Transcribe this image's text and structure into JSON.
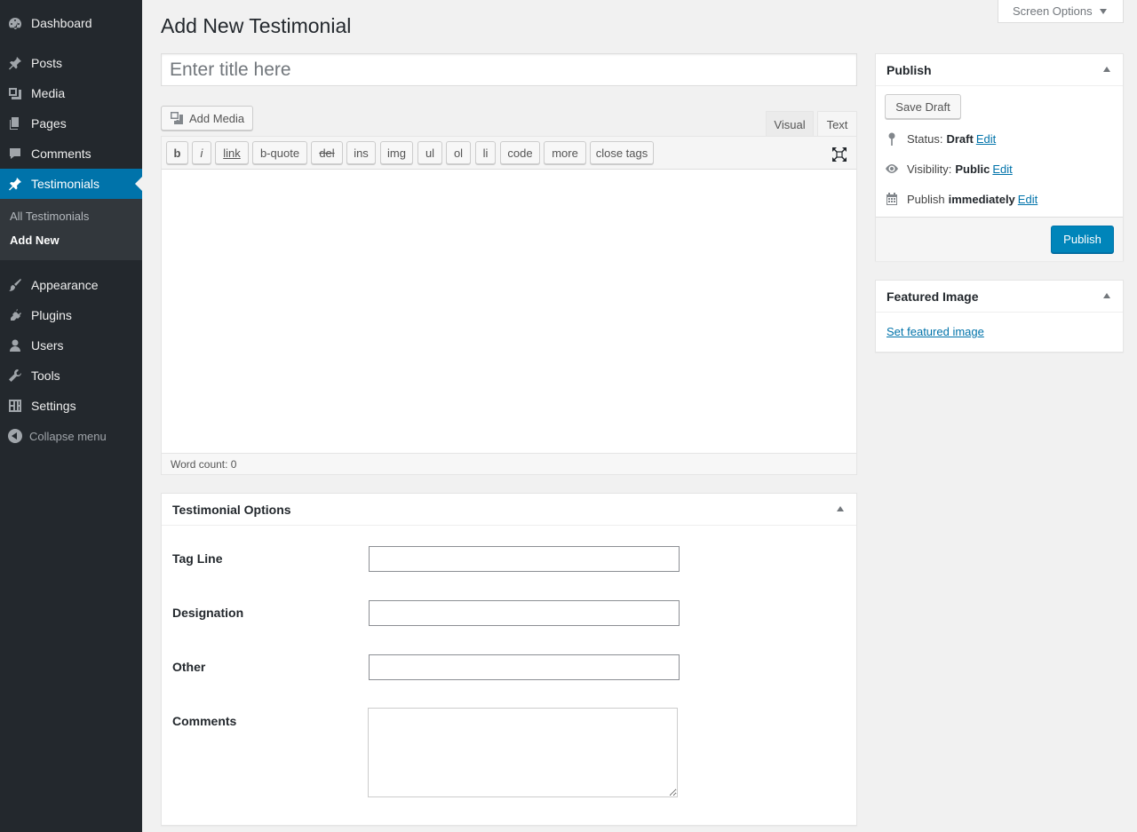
{
  "sidebar": {
    "items": [
      {
        "label": "Dashboard",
        "icon": "dashboard-icon"
      },
      {
        "label": "Posts",
        "icon": "pushpin-icon"
      },
      {
        "label": "Media",
        "icon": "media-icon"
      },
      {
        "label": "Pages",
        "icon": "pages-icon"
      },
      {
        "label": "Comments",
        "icon": "comment-icon"
      },
      {
        "label": "Testimonials",
        "icon": "pushpin-icon",
        "active": true
      },
      {
        "label": "Appearance",
        "icon": "brush-icon"
      },
      {
        "label": "Plugins",
        "icon": "plugin-icon"
      },
      {
        "label": "Users",
        "icon": "user-icon"
      },
      {
        "label": "Tools",
        "icon": "wrench-icon"
      },
      {
        "label": "Settings",
        "icon": "settings-icon"
      }
    ],
    "submenu": [
      {
        "label": "All Testimonials"
      },
      {
        "label": "Add New",
        "current": true
      }
    ],
    "collapse_label": "Collapse menu"
  },
  "header": {
    "title": "Add New Testimonial",
    "screen_options": "Screen Options"
  },
  "editor": {
    "title_placeholder": "Enter title here",
    "add_media": "Add Media",
    "tab_visual": "Visual",
    "tab_text": "Text",
    "quicktags": [
      "b",
      "i",
      "link",
      "b-quote",
      "del",
      "ins",
      "img",
      "ul",
      "ol",
      "li",
      "code",
      "more",
      "close tags"
    ],
    "word_count": "Word count: 0"
  },
  "testimonial_options": {
    "title": "Testimonial Options",
    "fields": [
      {
        "label": "Tag Line",
        "value": ""
      },
      {
        "label": "Designation",
        "value": ""
      },
      {
        "label": "Other",
        "value": ""
      },
      {
        "label": "Comments",
        "value": ""
      }
    ]
  },
  "publish": {
    "title": "Publish",
    "save_draft": "Save Draft",
    "status_label": "Status:",
    "status_value": "Draft",
    "visibility_label": "Visibility:",
    "visibility_value": "Public",
    "schedule_label": "Publish",
    "schedule_value": "immediately",
    "edit_link": "Edit",
    "publish_button": "Publish"
  },
  "featured_image": {
    "title": "Featured Image",
    "link": "Set featured image"
  },
  "colors": {
    "sidebar_bg": "#23282d",
    "active_menu": "#0073aa",
    "primary_button": "#0085ba",
    "link": "#0073aa"
  }
}
